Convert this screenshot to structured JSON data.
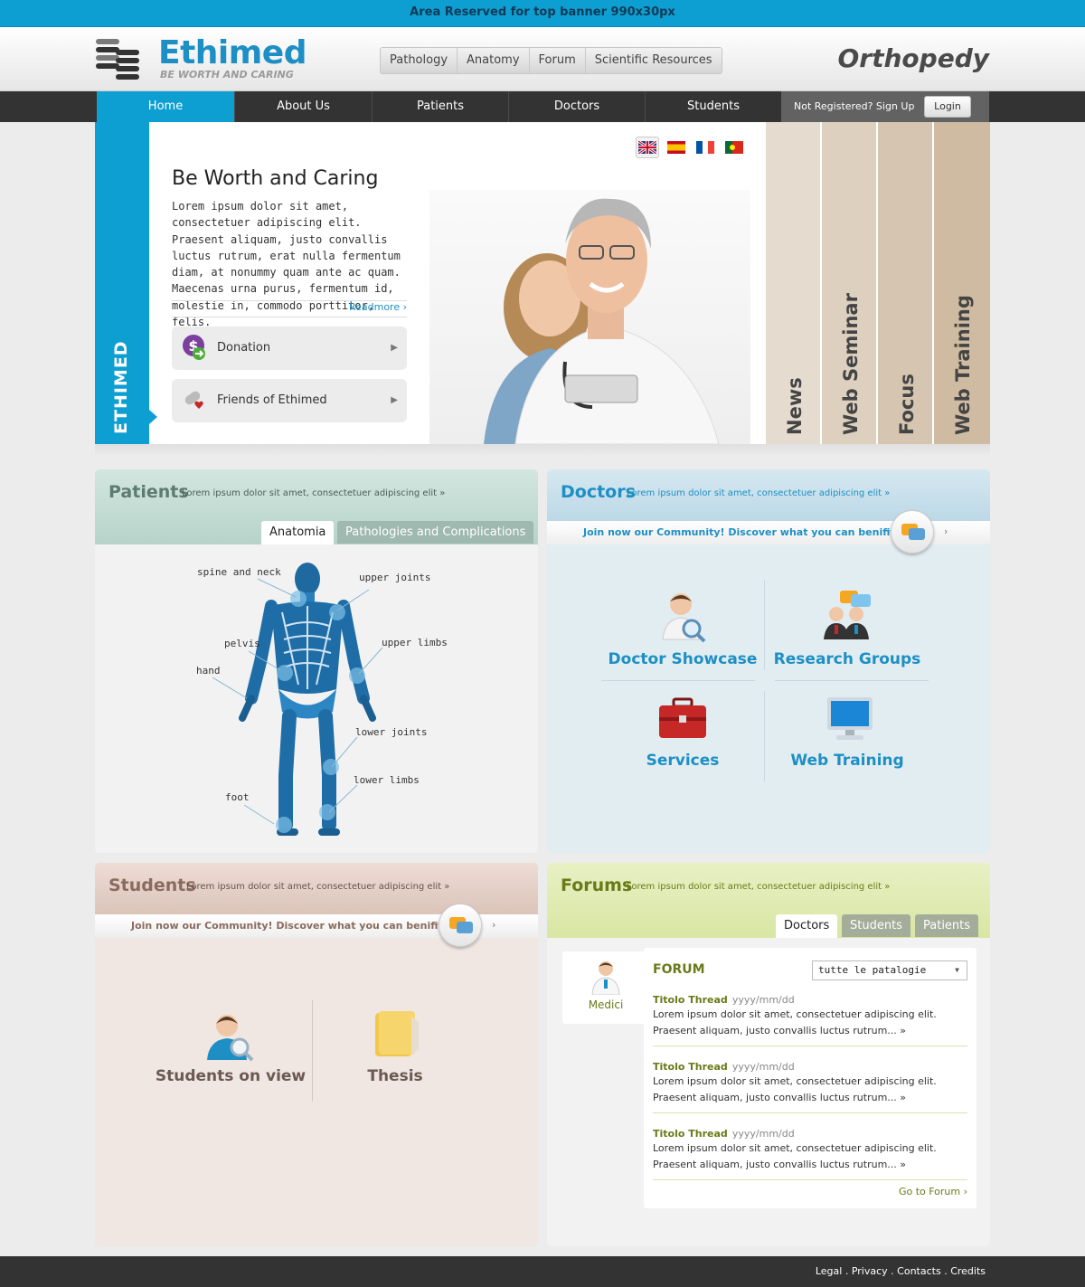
{
  "top_banner": "Area Reserved for top banner 990x30px",
  "header": {
    "logo_title": "Ethimed",
    "logo_tagline": "BE WORTH AND CARING",
    "top_nav": [
      "Pathology",
      "Anatomy",
      "Forum",
      "Scientific Resources"
    ],
    "section_title": "Orthopedy"
  },
  "main_nav": {
    "items": [
      "Home",
      "About Us",
      "Patients",
      "Doctors",
      "Students"
    ],
    "active": "Home",
    "signup_label": "Not Registered? Sign Up",
    "login_label": "Login"
  },
  "hero": {
    "side_label": "ETHIMED",
    "flags": [
      "uk-flag",
      "spain-flag",
      "france-flag",
      "portugal-flag"
    ],
    "title": "Be Worth and Caring",
    "text": "Lorem ipsum dolor sit amet, consectetuer adipiscing elit. Praesent aliquam, justo convallis luctus rutrum, erat nulla fermentum diam, at nonummy quam ante ac quam. Maecenas urna purus, fermentum id, molestie in, commodo porttitor, felis.",
    "readmore": "Readmore ›",
    "buttons": [
      {
        "label": "Donation",
        "icon": "money-icon"
      },
      {
        "label": "Friends of Ethimed",
        "icon": "friends-icon"
      }
    ],
    "vertical_tabs": [
      {
        "label": "News",
        "color": "#e5dccf"
      },
      {
        "label": "Web Seminar",
        "color": "#ddd0bf"
      },
      {
        "label": "Focus",
        "color": "#d6c6b1"
      },
      {
        "label": "Web Training",
        "color": "#cfbba1"
      }
    ]
  },
  "patients": {
    "title": "Patients",
    "subtitle": "Lorem ipsum dolor sit amet, consectetuer adipiscing elit »",
    "tabs": [
      "Anatomia",
      "Pathologies and Complications"
    ],
    "body_labels": {
      "spine_neck": "spine and neck",
      "upper_joints": "upper joints",
      "pelvis": "pelvis",
      "upper_limbs": "upper limbs",
      "hand": "hand",
      "lower_joints": "lower joints",
      "lower_limbs": "lower limbs",
      "foot": "foot"
    }
  },
  "doctors": {
    "title": "Doctors",
    "subtitle": "Lorem ipsum dolor sit amet, consectetuer adipiscing elit »",
    "join": "Join now our Community! Discover what you can benifit from",
    "tiles": [
      "Doctor Showcase",
      "Research Groups",
      "Services",
      "Web Training"
    ]
  },
  "students": {
    "title": "Students",
    "subtitle": "Lorem ipsum dolor sit amet, consectetuer adipiscing elit »",
    "join": "Join now our Community! Discover what you can benifit from",
    "tiles": [
      "Students on view",
      "Thesis"
    ]
  },
  "forums": {
    "title": "Forums",
    "subtitle": "Lorem ipsum dolor sit amet, consectetuer adipiscing elit »",
    "tabs": [
      "Doctors",
      "Students",
      "Patients"
    ],
    "avatar_label": "Medici",
    "box_title": "FORUM",
    "select_value": "tutte le patalogie",
    "threads": [
      {
        "title": "Titolo Thread",
        "date": "yyyy/mm/dd",
        "text": "Lorem ipsum dolor sit amet, consectetuer adipiscing elit. Praesent aliquam, justo convallis luctus rutrum... »"
      },
      {
        "title": "Titolo Thread",
        "date": "yyyy/mm/dd",
        "text": "Lorem ipsum dolor sit amet, consectetuer adipiscing elit. Praesent aliquam, justo convallis luctus rutrum... »"
      },
      {
        "title": "Titolo Thread",
        "date": "yyyy/mm/dd",
        "text": "Lorem ipsum dolor sit amet, consectetuer adipiscing elit. Praesent aliquam, justo convallis luctus rutrum... »"
      }
    ],
    "go_to_forum": "Go to Forum ›"
  },
  "footer": {
    "links": [
      "Legal",
      "Privacy",
      "Contacts",
      "Credits"
    ],
    "separator": "."
  },
  "colors": {
    "accent": "#0e9fd2",
    "dark_nav": "#333333",
    "patients_head": "#c6ded6",
    "doctors_head": "#c9e0ec",
    "students_head": "#e4cfc7",
    "forums_head": "#e0ebb8"
  }
}
